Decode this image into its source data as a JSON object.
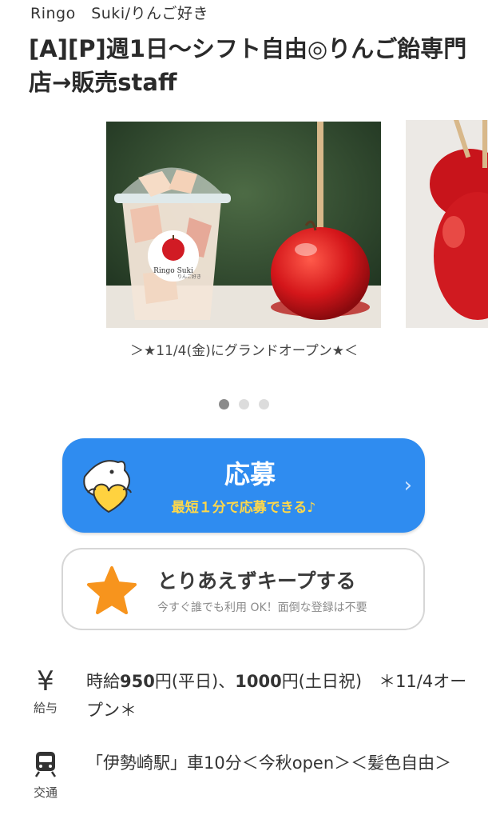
{
  "company": "Ringo　Suki/りんご好き",
  "title": "[A][P]週1日〜シフト自由◎りんご飴専門店→販売staff",
  "carousel": {
    "caption": "＞★11/4(金)にグランドオープン★＜",
    "cup_logo_line1": "Ringo Suki",
    "cup_logo_line2": "りんご好き",
    "dots": 3,
    "active_dot": 0
  },
  "apply": {
    "label": "応募",
    "sublabel": "最短１分で応募できる♪",
    "chevron": "›",
    "color": "#2f8cf0",
    "sub_color": "#ffd84a"
  },
  "keep": {
    "label": "とりあえずキープする",
    "sublabel": "今すぐ誰でも利用 OK！面倒な登録は不要",
    "star_color": "#f7941d"
  },
  "salary": {
    "icon_label": "給与",
    "text_pre": "時給",
    "amount1": "950",
    "text_mid": "円(平日)、",
    "amount2": "1000",
    "text_post": "円(土日祝)　＊11/4オープン＊"
  },
  "transport": {
    "icon_label": "交通",
    "text": "「伊勢崎駅」車10分＜今秋open＞＜髪色自由＞"
  }
}
